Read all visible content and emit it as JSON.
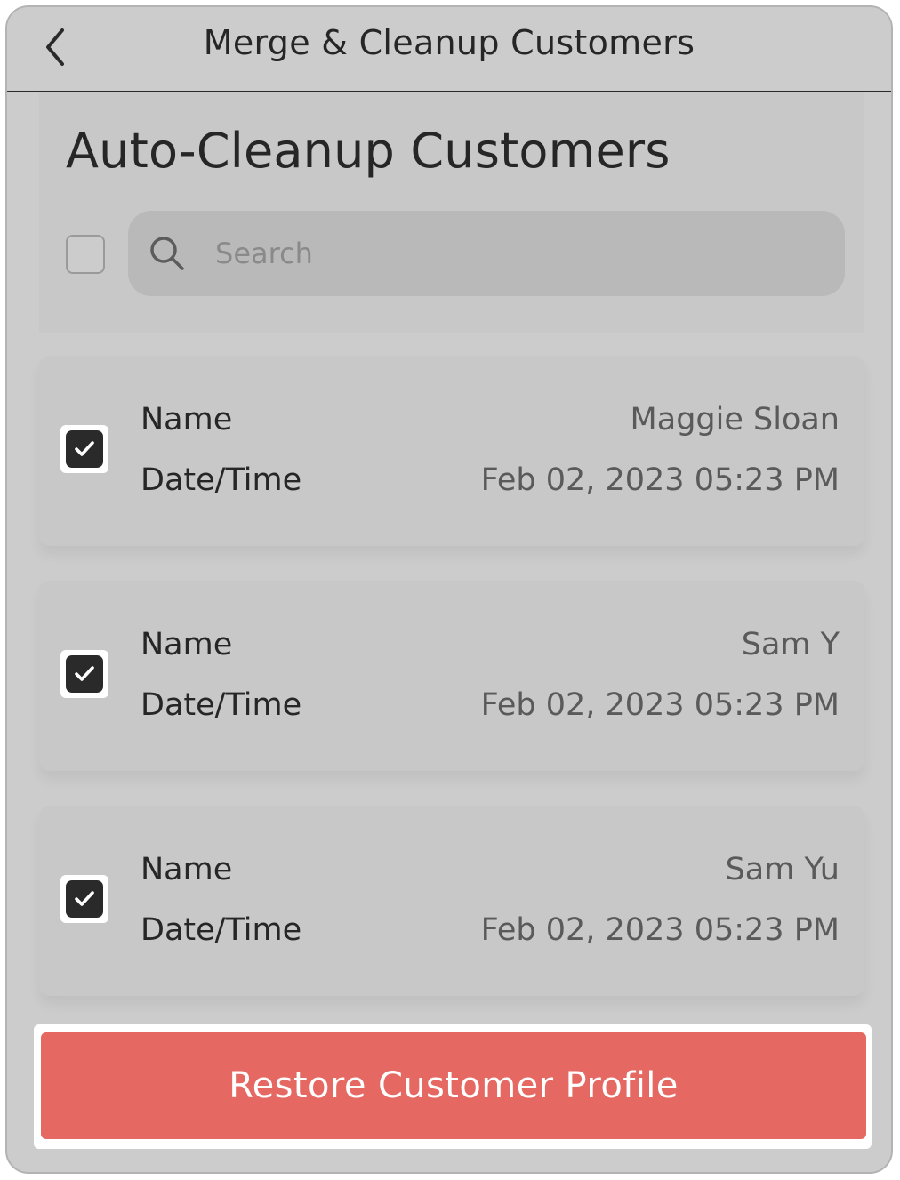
{
  "header": {
    "title": "Merge & Cleanup Customers",
    "back_icon": "chevron-left-icon"
  },
  "section": {
    "title": "Auto-Cleanup Customers",
    "select_all_checked": false,
    "search": {
      "placeholder": "Search",
      "value": "",
      "icon": "search-icon"
    }
  },
  "customers": [
    {
      "name_label": "Name",
      "name": "Maggie Sloan",
      "date_label": "Date/Time",
      "datetime": "Feb 02, 2023 05:23 PM",
      "checked": true
    },
    {
      "name_label": "Name",
      "name": "Sam Y",
      "date_label": "Date/Time",
      "datetime": "Feb 02, 2023 05:23 PM",
      "checked": true
    },
    {
      "name_label": "Name",
      "name": "Sam Yu",
      "date_label": "Date/Time",
      "datetime": "Feb 02, 2023 05:23 PM",
      "checked": true
    }
  ],
  "footer": {
    "restore_label": "Restore Customer Profile"
  },
  "colors": {
    "background": "#cccccc",
    "primary_button": "#e56863",
    "checkbox_checked": "#2a2a2a"
  }
}
